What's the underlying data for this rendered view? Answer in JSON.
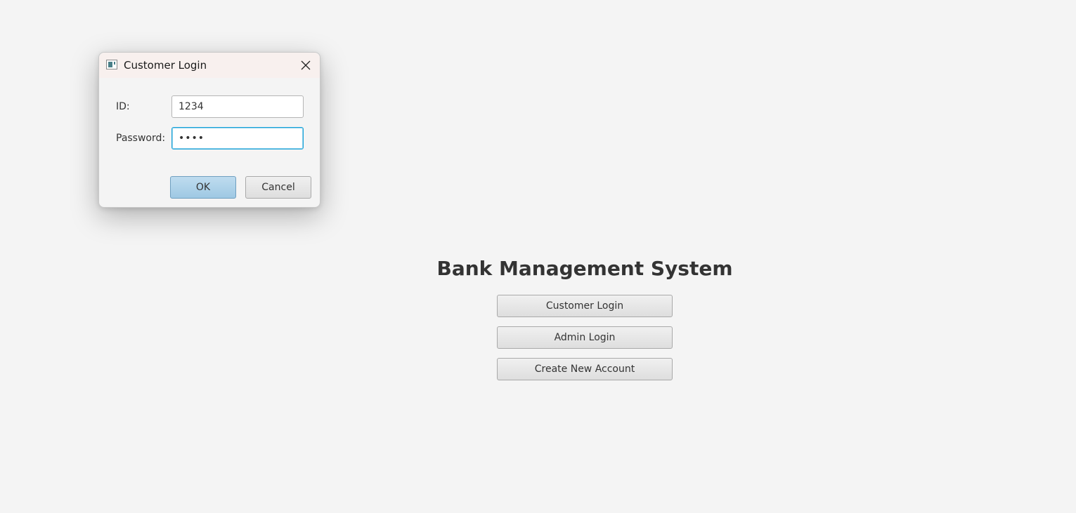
{
  "main": {
    "title": "Bank Management System",
    "buttons": {
      "customer_login": "Customer Login",
      "admin_login": "Admin Login",
      "create_account": "Create New Account"
    }
  },
  "dialog": {
    "title": "Customer Login",
    "id_label": "ID:",
    "id_value": "1234",
    "password_label": "Password:",
    "password_value": "••••",
    "ok_label": "OK",
    "cancel_label": "Cancel",
    "icons": {
      "app": "window-app-icon",
      "close": "close-icon"
    }
  },
  "colors": {
    "background": "#f4f4f4",
    "focus_border": "#1aa3d9",
    "default_button": "#9ec8e3"
  }
}
